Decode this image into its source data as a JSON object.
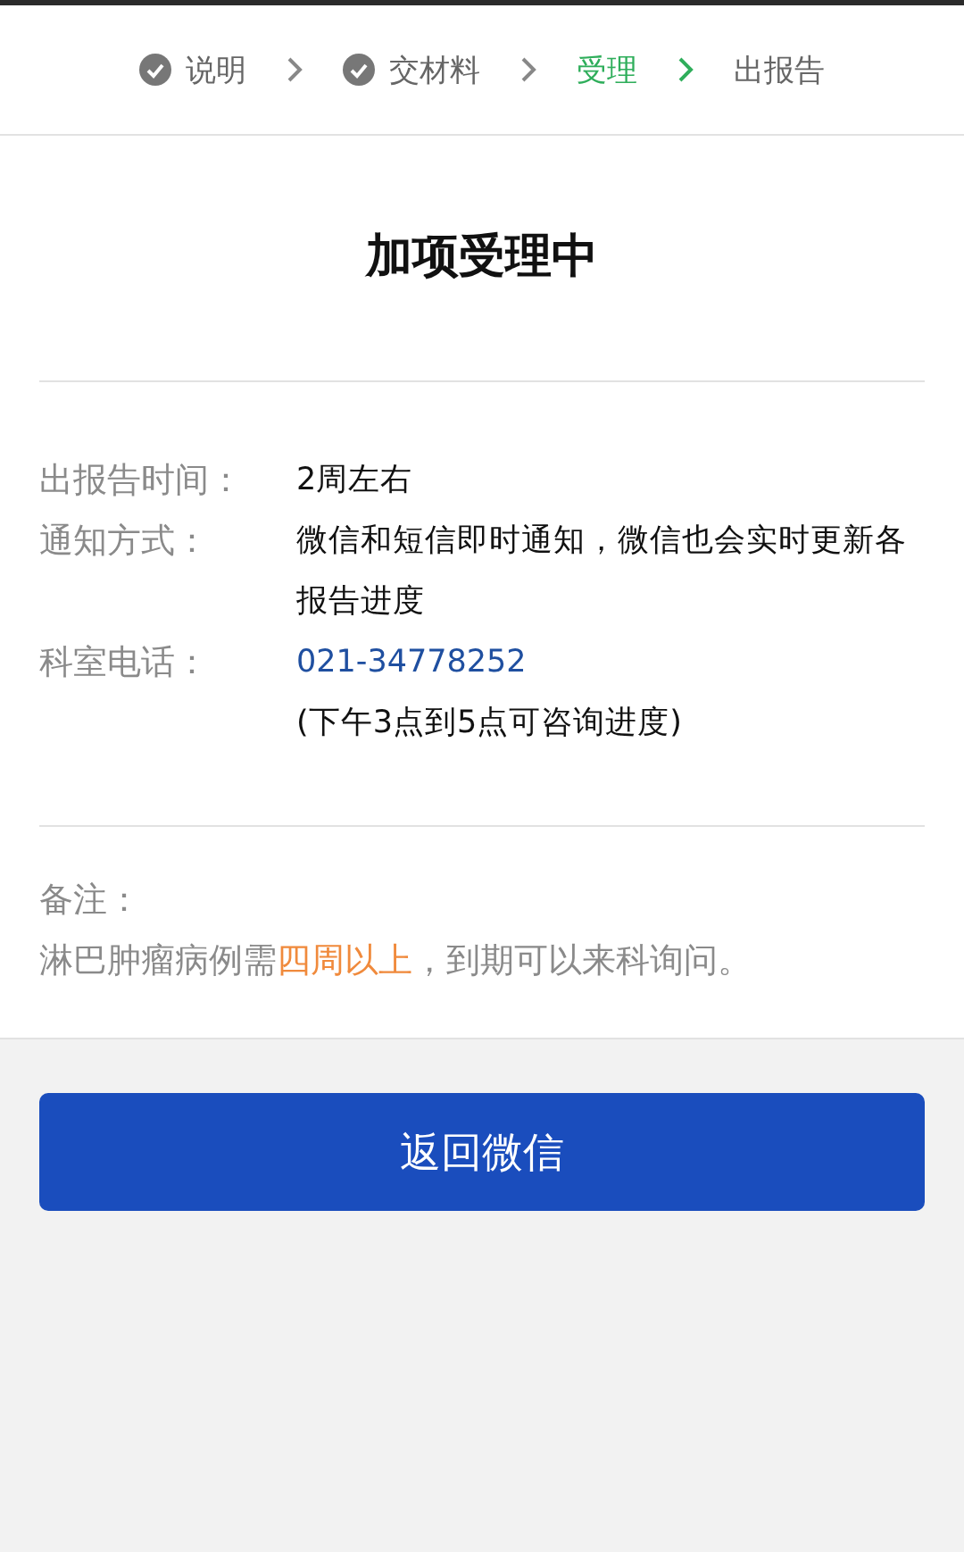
{
  "steps": [
    {
      "label": "说明",
      "done": true,
      "selected": false
    },
    {
      "label": "交材料",
      "done": true,
      "selected": false
    },
    {
      "label": "受理",
      "done": false,
      "selected": true
    },
    {
      "label": "出报告",
      "done": false,
      "selected": false
    }
  ],
  "title": "加项受理中",
  "details": [
    {
      "label": "出报告时间：",
      "lines": [
        {
          "kind": "text",
          "text": "2周左右"
        }
      ]
    },
    {
      "label": "通知方式：",
      "lines": [
        {
          "kind": "text",
          "text": "微信和短信即时通知，微信也会实时更新各报告进度"
        }
      ]
    },
    {
      "label": "科室电话：",
      "lines": [
        {
          "kind": "phone",
          "text": "021-34778252"
        },
        {
          "kind": "text",
          "text": "(下午3点到5点可咨询进度)"
        }
      ]
    }
  ],
  "note": {
    "label": "备注：",
    "segments": [
      {
        "text": "淋巴肿瘤病例需",
        "highlight": false
      },
      {
        "text": "四周以上",
        "highlight": true
      },
      {
        "text": "，到期可以来科询问。",
        "highlight": false
      }
    ]
  },
  "button": "返回微信"
}
